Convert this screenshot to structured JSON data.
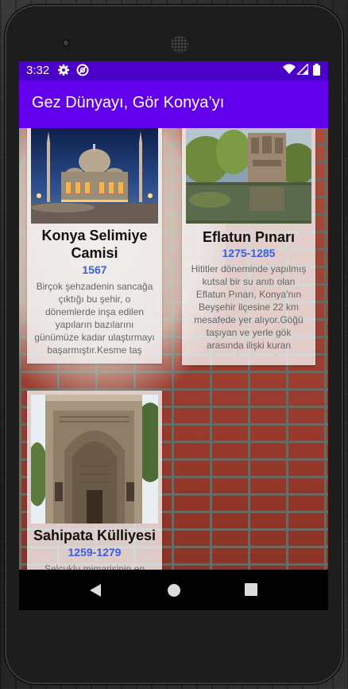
{
  "status": {
    "time": "3:32",
    "icons": [
      "gear-icon",
      "do-not-disturb-icon",
      "wifi-icon",
      "signal-icon",
      "battery-icon"
    ]
  },
  "app": {
    "title": "Gez Dünyayı, Gör Konya’yı"
  },
  "cards": [
    {
      "title": "Konya Selimiye Camisi",
      "year": "1567",
      "description": "Birçok şehzadenin sancağa çıktığı bu şehir, o dönemlerde inşa edilen yapıların bazılarını günümüze kadar ulaştırmayı başarmıştır.Kesme taş",
      "image": "mosque-night-photo"
    },
    {
      "title": "Eflatun Pınarı",
      "year": "1275-1285",
      "description": "Hititler döneminde yapılmış kutsal bir su anıtı olan Eflatun Pınarı, Konya'nın Beyşehir ilçesine 22 km mesafede yer alıyor.Göğü taşıyan ve yerle gök arasında ilişki kuran tanrıların tasvir",
      "image": "stone-monument-pond-photo"
    },
    {
      "title": "Sahipata Külliyesi",
      "year": "1259-1279",
      "description": "Selçuklu mimarisinin en",
      "image": "carved-stone-portal-photo"
    }
  ],
  "navigation": {
    "buttons": [
      "back-button",
      "home-button",
      "recents-button"
    ]
  },
  "colors": {
    "status_bar": "#4a00c8",
    "app_bar": "#6200ee",
    "year_text": "#3b5fe0"
  }
}
